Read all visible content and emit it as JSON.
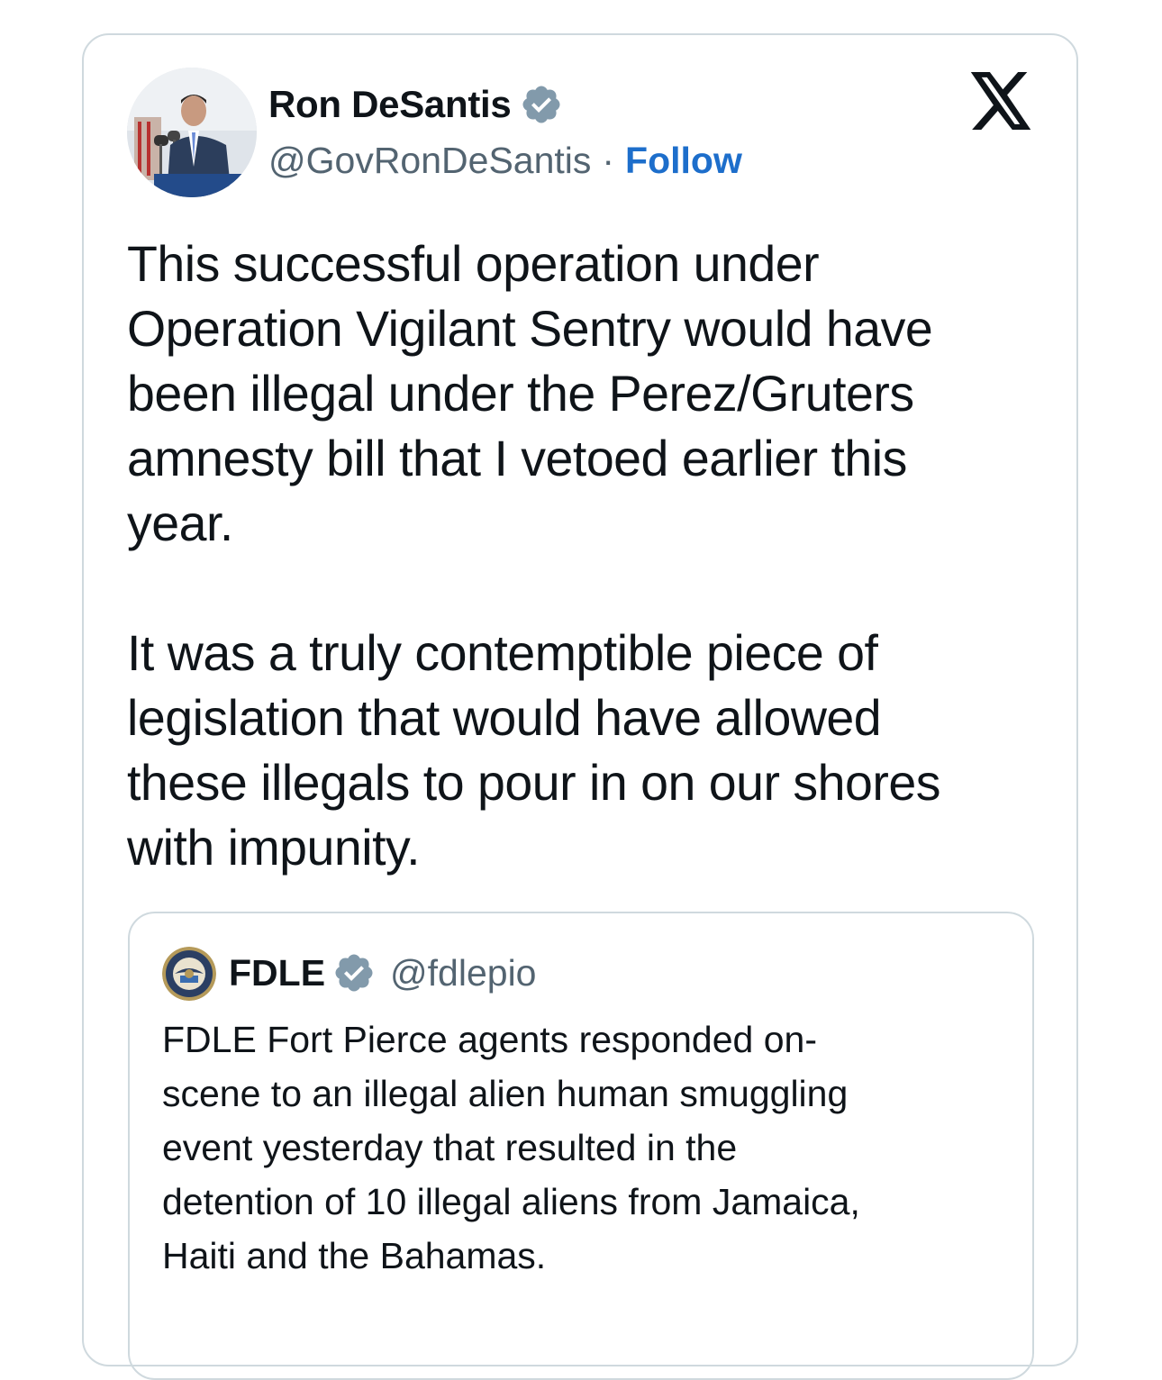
{
  "colors": {
    "link": "#1d6ecb",
    "muted": "#536471",
    "border": "#cfd9de",
    "verified_badge": "#829aab"
  },
  "tweet": {
    "author_name": "Ron DeSantis",
    "author_handle": "@GovRonDeSantis",
    "separator": "·",
    "follow_label": "Follow",
    "text": "This successful operation under\nOperation Vigilant Sentry would have\nbeen illegal under the Perez/Gruters\namnesty bill that I vetoed earlier this\nyear.\n\nIt was a truly contemptible piece of\nlegislation that would have allowed\nthese illegals to pour in on our shores\nwith impunity."
  },
  "quoted_tweet": {
    "author_name": "FDLE",
    "author_handle": "@fdlepio",
    "text": "FDLE Fort Pierce agents responded on-\nscene to an illegal alien human smuggling\nevent yesterday that resulted in the\ndetention of 10 illegal aliens from Jamaica,\nHaiti and the Bahamas."
  },
  "icons": {
    "platform_logo": "x-logo-icon",
    "verified": "verified-badge-icon"
  }
}
